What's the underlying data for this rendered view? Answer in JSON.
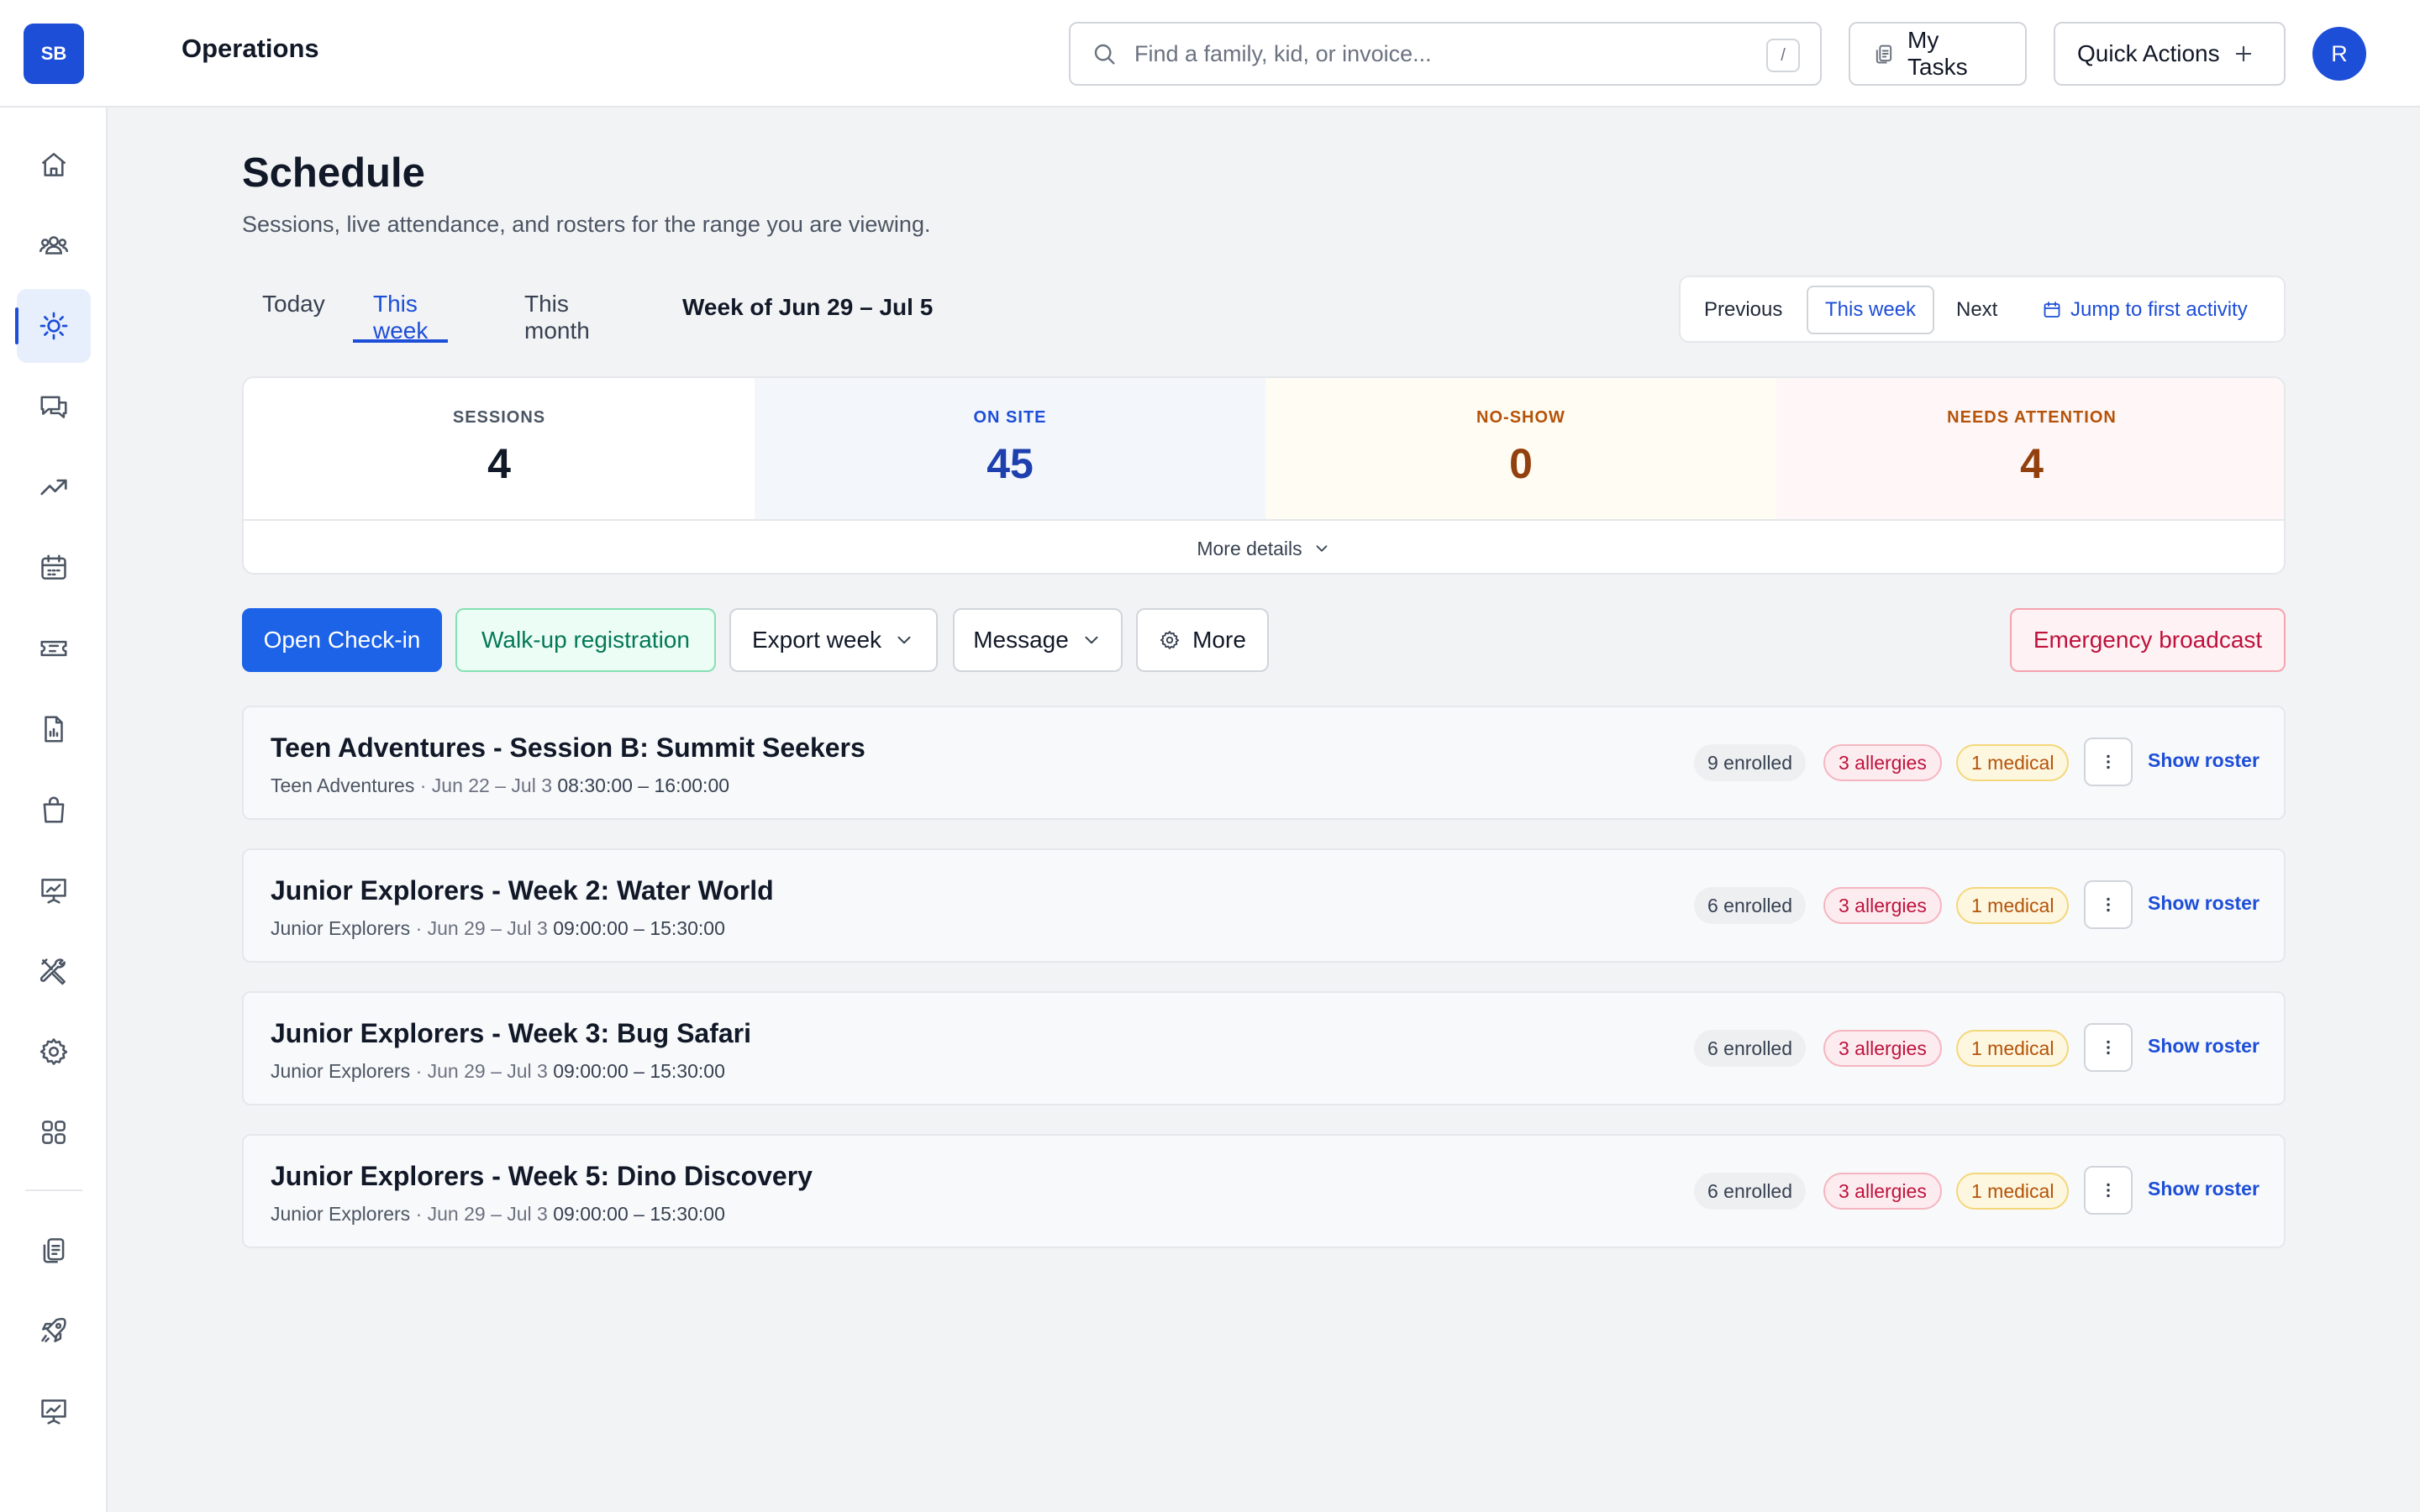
{
  "header": {
    "logo_text": "SB",
    "app_title": "Operations",
    "search_placeholder": "Find a family, kid, or invoice...",
    "search_shortcut": "/",
    "my_tasks_label": "My Tasks",
    "quick_actions_label": "Quick Actions",
    "avatar_initial": "R"
  },
  "sidebar": {
    "items": [
      {
        "icon": "home-icon"
      },
      {
        "icon": "families-icon"
      },
      {
        "icon": "sun-icon",
        "active": true
      },
      {
        "icon": "chat-icon"
      },
      {
        "icon": "trending-icon"
      },
      {
        "icon": "calendar-icon"
      },
      {
        "icon": "ticket-icon"
      },
      {
        "icon": "report-icon"
      },
      {
        "icon": "shopping-bag-icon"
      },
      {
        "icon": "presentation-chart-icon"
      },
      {
        "icon": "tools-icon"
      },
      {
        "icon": "settings-icon"
      },
      {
        "icon": "apps-grid-icon"
      },
      {
        "icon": "clipboard-icon"
      },
      {
        "icon": "rocket-icon"
      },
      {
        "icon": "presentation-chart-icon"
      }
    ]
  },
  "page": {
    "title": "Schedule",
    "subtitle": "Sessions, live attendance, and rosters for the range you are viewing."
  },
  "tabs": [
    {
      "label": "Today"
    },
    {
      "label": "This week",
      "active": true
    },
    {
      "label": "This month"
    }
  ],
  "week_label": "Week of Jun 29 – Jul 5",
  "range_nav": {
    "previous": "Previous",
    "current": "This week",
    "next": "Next",
    "jump": "Jump to first activity"
  },
  "stats": [
    {
      "label": "SESSIONS",
      "value": "4",
      "bg": "#ffffff",
      "label_color": "#4b5563",
      "value_color": "#111827"
    },
    {
      "label": "ON SITE",
      "value": "45",
      "bg": "#f3f7fc",
      "label_color": "#1d4ed8",
      "value_color": "#1e40af"
    },
    {
      "label": "NO-SHOW",
      "value": "0",
      "bg": "#fffcf3",
      "label_color": "#b45309",
      "value_color": "#92400e"
    },
    {
      "label": "NEEDS ATTENTION",
      "value": "4",
      "bg": "#fff7f7",
      "label_color": "#b45309",
      "value_color": "#92400e"
    }
  ],
  "more_details": "More details",
  "actions": {
    "open_checkin": "Open Check-in",
    "walkup": "Walk-up registration",
    "export": "Export week",
    "message": "Message",
    "more": "More",
    "emergency": "Emergency broadcast"
  },
  "sessions": [
    {
      "title": "Teen Adventures - Session B: Summit Seekers",
      "program": "Teen Adventures",
      "dates": "· Jun 22 – Jul 3",
      "time": "08:30:00 – 16:00:00",
      "enrolled": "9 enrolled",
      "allergies": "3 allergies",
      "medical": "1 medical",
      "roster": "Show roster"
    },
    {
      "title": "Junior Explorers - Week 2: Water World",
      "program": "Junior Explorers",
      "dates": "· Jun 29 – Jul 3",
      "time": "09:00:00 – 15:30:00",
      "enrolled": "6 enrolled",
      "allergies": "3 allergies",
      "medical": "1 medical",
      "roster": "Show roster"
    },
    {
      "title": "Junior Explorers - Week 3: Bug Safari",
      "program": "Junior Explorers",
      "dates": "· Jun 29 – Jul 3",
      "time": "09:00:00 – 15:30:00",
      "enrolled": "6 enrolled",
      "allergies": "3 allergies",
      "medical": "1 medical",
      "roster": "Show roster"
    },
    {
      "title": "Junior Explorers - Week 5: Dino Discovery",
      "program": "Junior Explorers",
      "dates": "· Jun 29 – Jul 3",
      "time": "09:00:00 – 15:30:00",
      "enrolled": "6 enrolled",
      "allergies": "3 allergies",
      "medical": "1 medical",
      "roster": "Show roster"
    }
  ],
  "colors": {
    "accent": "#1d4ed8",
    "primary_button": "#1d63e8",
    "danger": "#be123c"
  }
}
